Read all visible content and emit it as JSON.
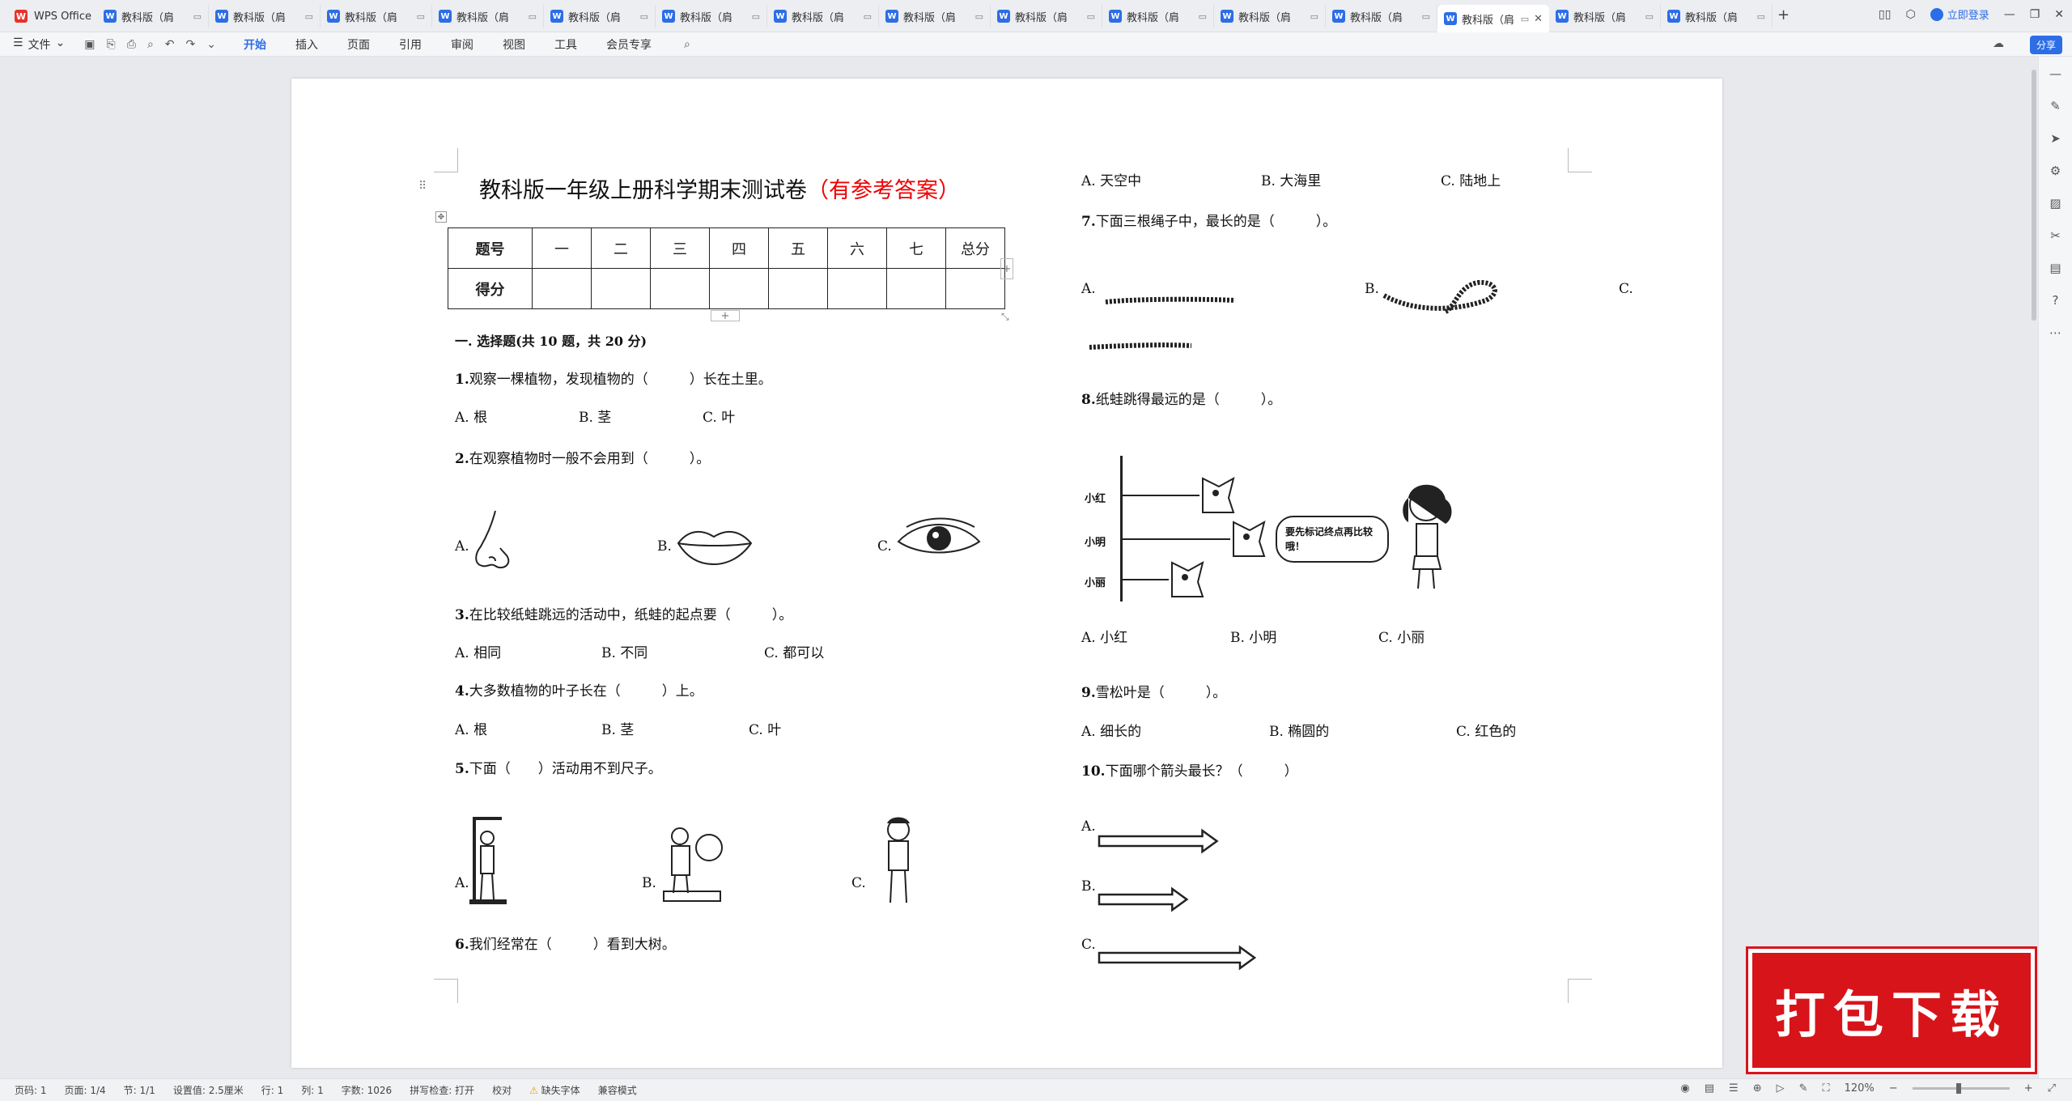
{
  "tabbar": {
    "app_name": "WPS Office",
    "doc_tabs": [
      "教科版（肩",
      "教科版（肩",
      "教科版（肩",
      "教科版（肩",
      "教科版（肩",
      "教科版（肩",
      "教科版（肩",
      "教科版（肩",
      "教科版（肩",
      "教科版（肩",
      "教科版（肩",
      "教科版（肩",
      "教科版（肩",
      "教科版（肩",
      "教科版（肩"
    ],
    "active_tab_index": 12,
    "add_tab": "+",
    "login_label": "立即登录"
  },
  "menubar": {
    "file_label": "文件",
    "tabs": [
      "开始",
      "插入",
      "页面",
      "引用",
      "审阅",
      "视图",
      "工具",
      "会员专享"
    ],
    "active_tab": "开始",
    "share_label": "分享"
  },
  "doc": {
    "title_main": "教科版一年级上册科学期末测试卷",
    "title_red": "（有参考答案）",
    "score_table": {
      "headers": [
        "题号",
        "一",
        "二",
        "三",
        "四",
        "五",
        "六",
        "七",
        "总分"
      ],
      "row2_label": "得分"
    },
    "section1": "一. 选择题(共 10 题，共 20 分)",
    "q1": {
      "num": "1.",
      "text": "观察一棵植物，发现植物的（　　　）长在土里。",
      "opts": [
        "A. 根",
        "B. 茎",
        "C. 叶"
      ]
    },
    "q2": {
      "num": "2.",
      "text": "在观察植物时一般不会用到（　　　）。",
      "opts": [
        "A.",
        "B.",
        "C."
      ],
      "pics": [
        "nose-picture",
        "lips-picture",
        "eye-picture"
      ]
    },
    "q3": {
      "num": "3.",
      "text": "在比较纸蛙跳远的活动中，纸蛙的起点要（　　　）。",
      "opts": [
        "A. 相同",
        "B. 不同",
        "C. 都可以"
      ]
    },
    "q4": {
      "num": "4.",
      "text": "大多数植物的叶子长在（　　　）上。",
      "opts": [
        "A. 根",
        "B. 茎",
        "C. 叶"
      ]
    },
    "q5": {
      "num": "5.",
      "text": "下面（　　）活动用不到尺子。",
      "opts": [
        "A.",
        "B.",
        "C."
      ]
    },
    "q6": {
      "num": "6.",
      "text": "我们经常在（　　　）看到大树。",
      "opts": [
        "A. 天空中",
        "B. 大海里",
        "C. 陆地上"
      ]
    },
    "q7": {
      "num": "7.",
      "text": "下面三根绳子中，最长的是（　　　）。",
      "opts": [
        "A.",
        "B.",
        "C."
      ]
    },
    "q8": {
      "num": "8.",
      "text": "纸蛙跳得最远的是（　　　）。",
      "opts": [
        "A. 小红",
        "B. 小明",
        "C. 小丽"
      ],
      "names": [
        "小红",
        "小明",
        "小丽"
      ],
      "bubble": "要先标记终点再比较哦！"
    },
    "q9": {
      "num": "9.",
      "text": "雪松叶是（　　　）。",
      "opts": [
        "A. 细长的",
        "B. 椭圆的",
        "C. 红色的"
      ]
    },
    "q10": {
      "num": "10.",
      "text": "下面哪个箭头最长？（　　　）",
      "opts": [
        "A.",
        "B.",
        "C."
      ],
      "arrow_lengths": [
        0.75,
        0.55,
        1.0
      ]
    }
  },
  "stamp_text": "打包下载",
  "statusbar": {
    "page_num": "页码: 1",
    "pages": "页面: 1/4",
    "section": "节: 1/1",
    "setting": "设置值: 2.5厘米",
    "row": "行: 1",
    "col": "列: 1",
    "word_count": "字数: 1026",
    "spell_check": "拼写检查: 打开",
    "proofread": "校对",
    "missing_font": "缺失字体",
    "compat_mode": "兼容模式",
    "zoom": "120%"
  }
}
